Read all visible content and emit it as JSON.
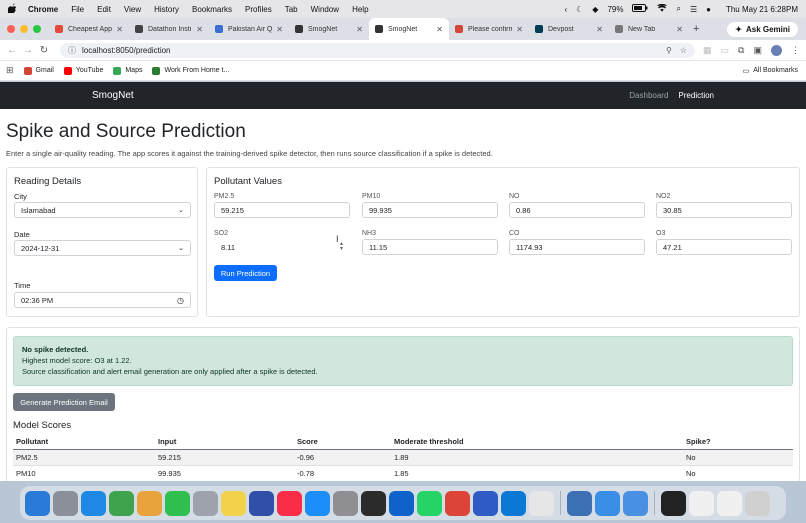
{
  "menubar": {
    "app": "Chrome",
    "items": [
      "File",
      "Edit",
      "View",
      "History",
      "Bookmarks",
      "Profiles",
      "Tab",
      "Window",
      "Help"
    ],
    "battery": "79%",
    "datetime": "Thu May 21  6:28PM"
  },
  "tabs": [
    {
      "title": "Cheapest App",
      "active": false,
      "favicon_color": "#e34b3b"
    },
    {
      "title": "Datathon Insti",
      "active": false,
      "favicon_color": "#444444"
    },
    {
      "title": "Pakistan Air Q",
      "active": false,
      "favicon_color": "#3b6fd1"
    },
    {
      "title": "SmogNet",
      "active": false,
      "favicon_color": "#333333"
    },
    {
      "title": "SmogNet",
      "active": true,
      "favicon_color": "#333333"
    },
    {
      "title": "Please confirm",
      "active": false,
      "favicon_color": "#d44638"
    },
    {
      "title": "Devpost",
      "active": false,
      "favicon_color": "#003e54"
    },
    {
      "title": "New Tab",
      "active": false,
      "favicon_color": "#777777"
    }
  ],
  "gemini_label": "Ask Gemini",
  "address": "localhost:8050/prediction",
  "bookmarks": [
    {
      "label": "Gmail",
      "color": "#d44638"
    },
    {
      "label": "YouTube",
      "color": "#ff0000"
    },
    {
      "label": "Maps",
      "color": "#34a853"
    },
    {
      "label": "Work From Home t...",
      "color": "#2a7d2e"
    }
  ],
  "all_bookmarks": "All Bookmarks",
  "navbar": {
    "brand": "SmogNet",
    "links": [
      "Dashboard",
      "Prediction"
    ]
  },
  "page": {
    "title": "Spike and Source Prediction",
    "subtitle": "Enter a single air-quality reading. The app scores it against the training-derived spike detector, then runs source classification if a spike is detected."
  },
  "reading": {
    "heading": "Reading Details",
    "city_label": "City",
    "city_value": "Islamabad",
    "date_label": "Date",
    "date_value": "2024-12-31",
    "time_label": "Time",
    "time_value": "02:36 PM"
  },
  "pollutants": {
    "heading": "Pollutant Values",
    "fields": [
      {
        "label": "PM2.5",
        "value": "59.215"
      },
      {
        "label": "PM10",
        "value": "99.935"
      },
      {
        "label": "NO",
        "value": "0.86"
      },
      {
        "label": "NO2",
        "value": "30.85"
      },
      {
        "label": "SO2",
        "value": "8.11"
      },
      {
        "label": "NH3",
        "value": "11.15"
      },
      {
        "label": "CO",
        "value": "1174.93"
      },
      {
        "label": "O3",
        "value": "47.21"
      }
    ],
    "run_button": "Run Prediction"
  },
  "result": {
    "headline": "No spike detected.",
    "line2": "Highest model score: O3 at 1.22.",
    "line3": "Source classification and alert email generation are only applied after a spike is detected."
  },
  "email_button": "Generate Prediction Email",
  "scores": {
    "heading": "Model Scores",
    "columns": [
      "Pollutant",
      "Input",
      "Score",
      "Moderate threshold",
      "Spike?"
    ],
    "rows": [
      [
        "PM2.5",
        "59.215",
        "-0.96",
        "1.89",
        "No"
      ],
      [
        "PM10",
        "99.935",
        "-0.78",
        "1.85",
        "No"
      ]
    ]
  },
  "dock_colors": [
    "#2a7bd8",
    "#8a8f99",
    "#1e88e5",
    "#3fa34d",
    "#e8a33d",
    "#2fbf4f",
    "#9ea3ab",
    "#f2d24b",
    "#2f4fa8",
    "#fa2d48",
    "#1c8ef9",
    "#8e8e93",
    "#2b2b2b",
    "#0e62c9",
    "#25d366",
    "#db4437",
    "#2f5cc4",
    "#0a78d4",
    "#e6e6e6",
    "#3d6fb5",
    "#3a8ee6",
    "#4a90e2",
    "#222222",
    "#f0f0f0",
    "#f0f0f0",
    "#d0d0d0"
  ]
}
